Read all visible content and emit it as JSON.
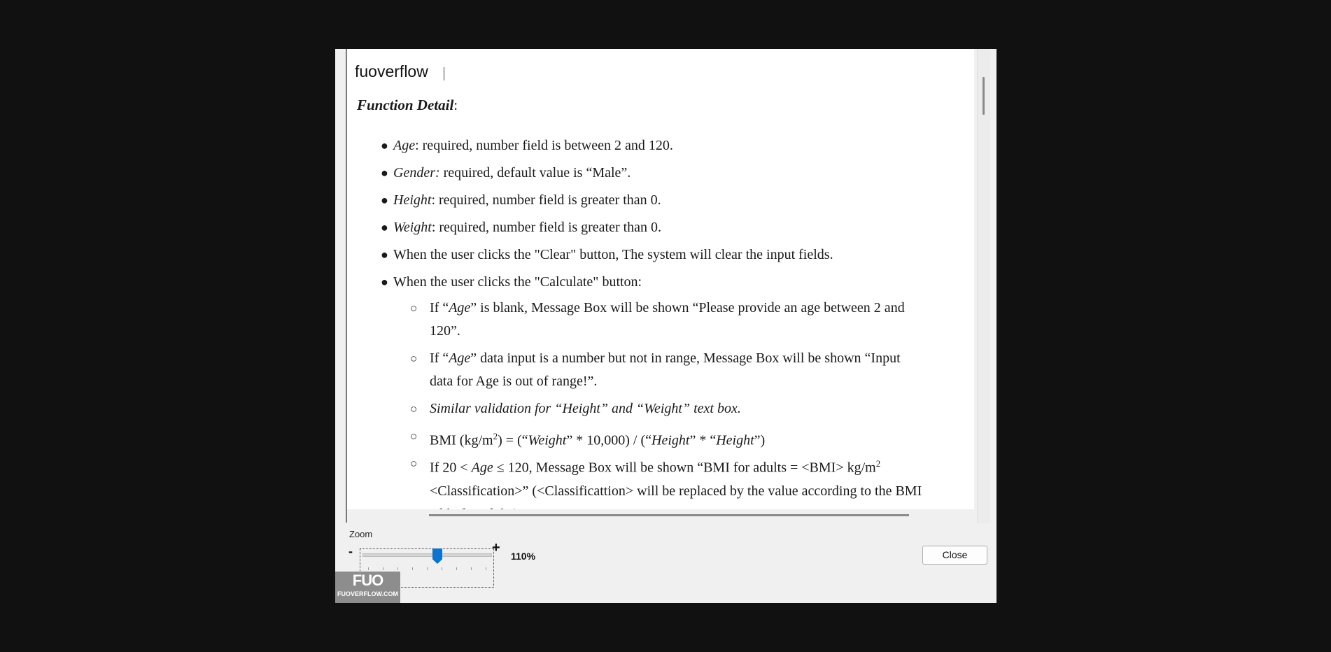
{
  "header": {
    "title": "fuoverflow"
  },
  "document": {
    "title": "Function Detail",
    "title_colon": ":",
    "bullets": [
      {
        "lead": "Age",
        "rest": ": required, number field is between 2 and 120."
      },
      {
        "lead": "Gender:",
        "rest": " required, default value is “Male”."
      },
      {
        "lead": "Height",
        "rest": ": required, number field is greater than 0."
      },
      {
        "lead": "Weight",
        "rest": ": required, number field is greater than 0."
      },
      {
        "lead": "",
        "rest": "When the user clicks the \"Clear\" button, The system will clear the input fields."
      },
      {
        "lead": "",
        "rest": "When the user clicks the \"Calculate\" button:"
      }
    ],
    "sub": {
      "s1": {
        "a": "If “",
        "b": "Age",
        "c": "” is blank, Message Box will be shown “Please provide an age between 2 and 120”."
      },
      "s2": {
        "a": "If “",
        "b": "Age",
        "c": "” data input is a number but not in range, Message Box will be shown “Input data for Age is out of range!”."
      },
      "s3": {
        "a": "Similar validation for “Height” and “Weight” text box."
      },
      "s4": {
        "a": "BMI (kg/m",
        "sup": "2",
        "b": ") = (“",
        "w": "Weight",
        "c": "” * 10,000) / (“",
        "h1": "Height",
        "d": "” * “",
        "h2": "Height",
        "e": "”)"
      },
      "s5": {
        "a": "If 20 < ",
        "b": "Age",
        "c": " ≤ 120, Message Box will be shown “BMI for adults = <BMI> kg/m",
        "sup": "2",
        "d": " <Classification>” (<Classificattion> will be replaced by the value according to the BMI table for adults)"
      }
    }
  },
  "footer": {
    "zoom_label": "Zoom",
    "minus": "-",
    "plus": "+",
    "zoom_value": "110%",
    "zoom_level_percent": 110,
    "close_label": "Close"
  },
  "watermark": {
    "logo": "FUO",
    "site": "FUOVERFLOW.COM"
  },
  "colors": {
    "background": "#111111",
    "dialog": "#f0f0f0",
    "slider_thumb": "#0a74d0",
    "watermark": "#8d8d8d"
  }
}
